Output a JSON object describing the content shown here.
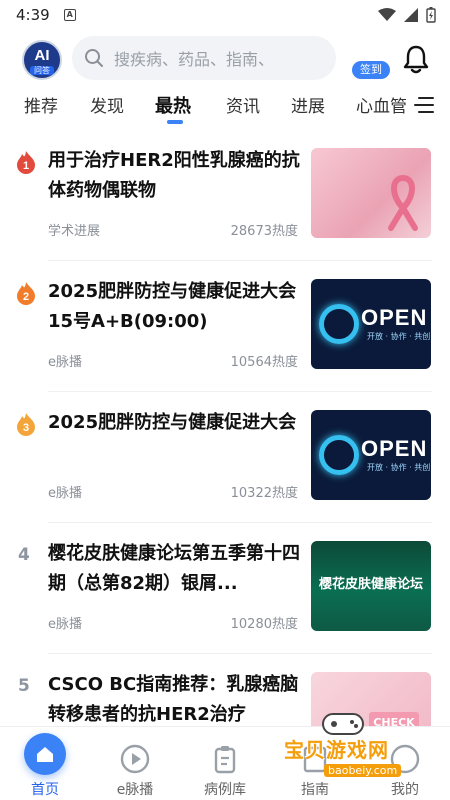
{
  "status_bar": {
    "time": "4:39",
    "notification_badge": "A"
  },
  "top_bar": {
    "logo": {
      "title": "AI",
      "subtitle": "问答"
    },
    "search": {
      "placeholder": "搜疾病、药品、指南、"
    },
    "signin_label": "签到"
  },
  "tabs": [
    {
      "label": "推荐"
    },
    {
      "label": "发现"
    },
    {
      "label": "最热",
      "active": true
    },
    {
      "label": "资讯"
    },
    {
      "label": "进展"
    },
    {
      "label": "心血管"
    }
  ],
  "feed": [
    {
      "rank": "1",
      "rank_color": "#e24a3b",
      "title": "用于治疗HER2阳性乳腺癌的抗体药物偶联物",
      "source": "学术进展",
      "heat": "28673热度",
      "thumb": "pink"
    },
    {
      "rank": "2",
      "rank_color": "#f07c2c",
      "title": "2025肥胖防控与健康促进大会 15号A+B(09:00)",
      "source": "e脉播",
      "heat": "10564热度",
      "thumb": "open"
    },
    {
      "rank": "3",
      "rank_color": "#f3a53a",
      "title": "2025肥胖防控与健康促进大会",
      "source": "e脉播",
      "heat": "10322热度",
      "thumb": "open"
    },
    {
      "rank": "4",
      "title": "樱花皮肤健康论坛第五季第十四期（总第82期）银屑...",
      "source": "e脉播",
      "heat": "10280热度",
      "thumb": "sakura",
      "thumb_text": "樱花皮肤健康论坛"
    },
    {
      "rank": "5",
      "title": "CSCO BC指南推荐：乳腺癌脑转移患者的抗HER2治疗",
      "source": "",
      "heat": "",
      "thumb": "csco",
      "thumb_text": "CHECK"
    }
  ],
  "open_thumb": {
    "word": "OPEN",
    "tagline": "开放 · 协作 · 共创"
  },
  "bottom_nav": [
    {
      "label": "首页",
      "icon": "home-icon",
      "active": true
    },
    {
      "label": "e脉播",
      "icon": "play-icon"
    },
    {
      "label": "病例库",
      "icon": "clipboard-icon"
    },
    {
      "label": "指南",
      "icon": "book-icon"
    },
    {
      "label": "我的",
      "icon": "user-icon"
    }
  ],
  "watermark": {
    "text": "宝贝游戏网",
    "url": "baobeiy.com"
  },
  "colors": {
    "accent": "#3b82f6",
    "nav_active": "#2563eb"
  }
}
